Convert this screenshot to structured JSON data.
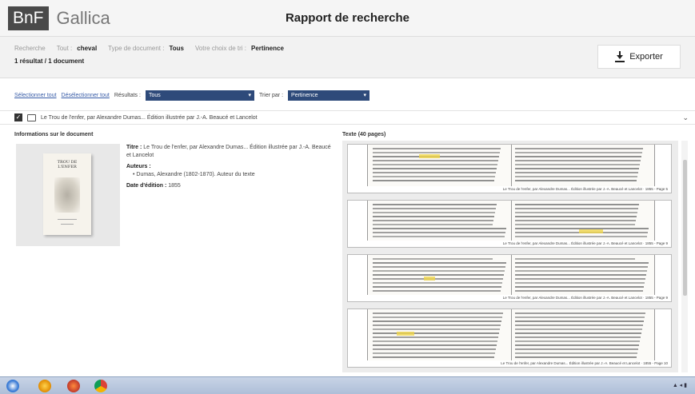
{
  "header": {
    "logo_abbr": "BnF",
    "logo_name": "Gallica",
    "title": "Rapport de recherche"
  },
  "search": {
    "recherche_label": "Recherche",
    "tout_label": "Tout :",
    "tout_value": "cheval",
    "type_label": "Type de document :",
    "type_value": "Tous",
    "tri_label": "Votre choix de tri :",
    "tri_value": "Pertinence",
    "summary": "1 résultat / 1 document",
    "export_label": "Exporter"
  },
  "selection": {
    "select_all": "Sélectionner tout",
    "deselect_all": "Désélectionner tout",
    "results_label": "Résultats :",
    "results_value": "Tous",
    "sort_label": "Trier par :",
    "sort_value": "Pertinence"
  },
  "result": {
    "header_title": "Le Trou de l'enfer, par Alexandre Dumas... Édition illustrée par J.-A. Beaucé et Lancelot",
    "info_title": "Informations sur le document",
    "thumb_title": "TROU DE L'ENFER",
    "meta": {
      "titre_label": "Titre :",
      "titre_value": "Le Trou de l'enfer, par Alexandre Dumas... Édition illustrée par J.-A. Beaucé et Lancelot",
      "auteurs_label": "Auteurs :",
      "auteur_value": "Dumas, Alexandre (1802-1870). Auteur du texte",
      "date_label": "Date d'édition :",
      "date_value": "1855"
    },
    "texte_title": "Texte (40 pages)",
    "snippets": [
      {
        "caption": "Le Trou de l'enfer, par Alexandre Dumas... Édition illustrée par J.-A. Beaucé et Lancelot · 1855 - Page 5"
      },
      {
        "caption": "Le Trou de l'enfer, par Alexandre Dumas... Édition illustrée par J.-A. Beaucé et Lancelot · 1855 - Page 9"
      },
      {
        "caption": "Le Trou de l'enfer, par Alexandre Dumas... Édition illustrée par J.-A. Beaucé et Lancelot · 1855 - Page 9"
      },
      {
        "caption": "Le Trou de l'enfer, par Alexandre Dumas... Édition illustrée par J.-A. Beaucé et Lancelot · 1855 - Page 10"
      }
    ]
  },
  "icons": {
    "download": "download-icon",
    "checkbox": "checkbox-icon",
    "document": "document-icon",
    "chevron": "chevron-down-icon"
  },
  "colors": {
    "select_bg": "#2e4a7a",
    "link": "#3a5ea8",
    "highlight": "#f0d64a"
  }
}
